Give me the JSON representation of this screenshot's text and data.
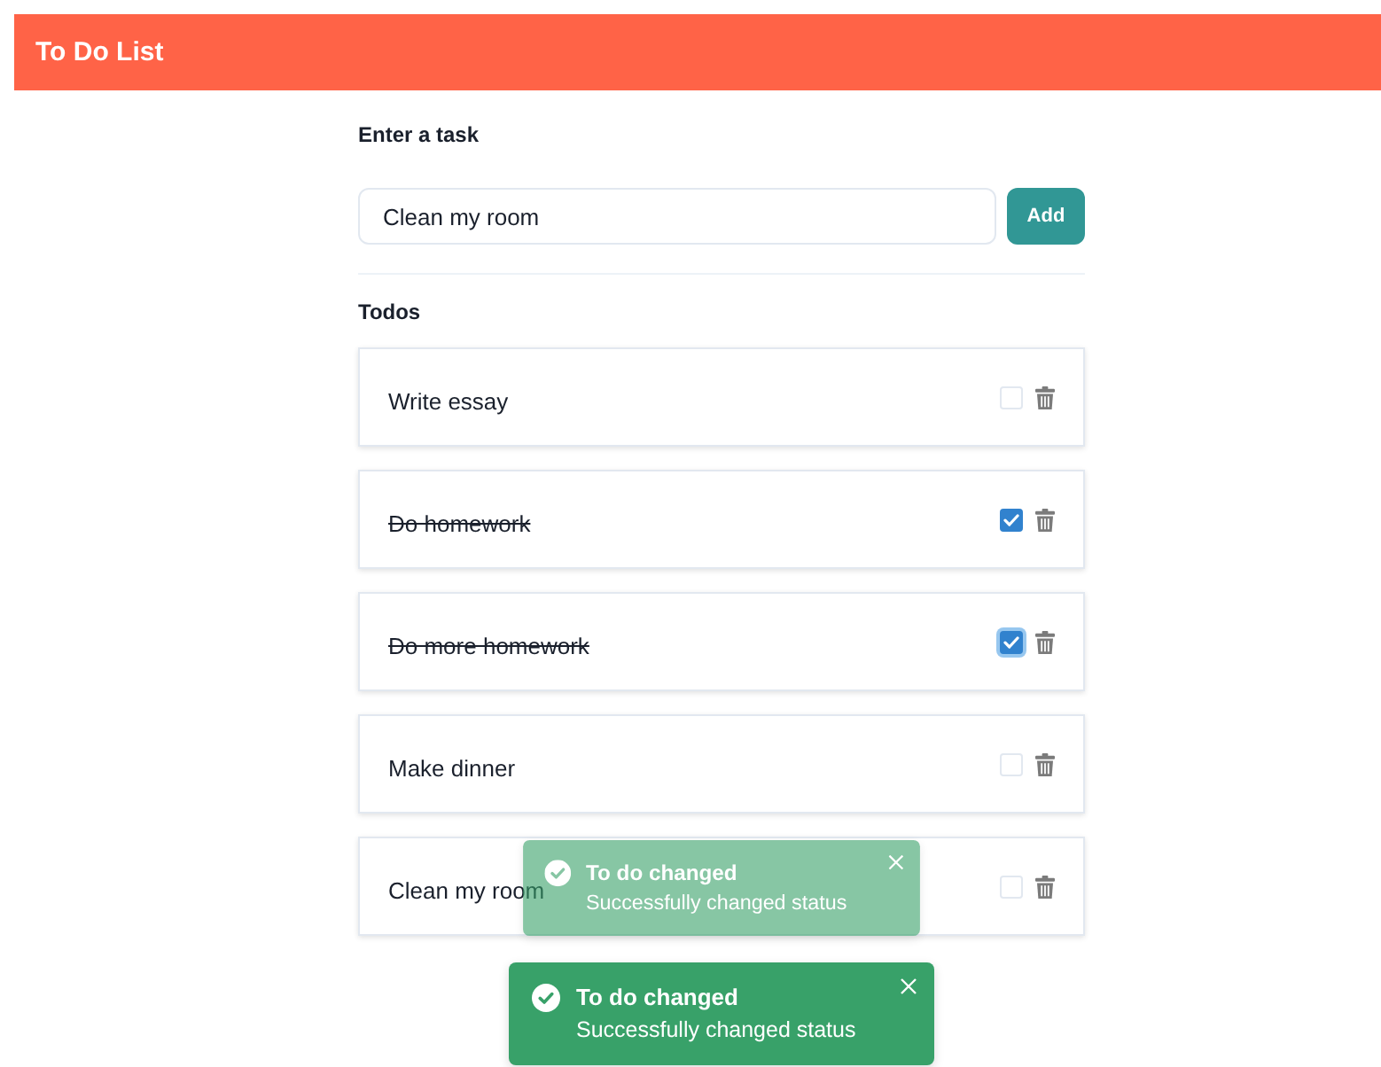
{
  "header": {
    "title": "To Do List"
  },
  "task_form": {
    "label": "Enter a task",
    "input": {
      "value": "Clean my room"
    },
    "button": "Add"
  },
  "todos": {
    "heading": "Todos",
    "items": [
      {
        "text": "Write essay",
        "done": false,
        "focused": false
      },
      {
        "text": "Do homework",
        "done": true,
        "focused": false
      },
      {
        "text": "Do more homework",
        "done": true,
        "focused": true
      },
      {
        "text": "Make dinner",
        "done": false,
        "focused": false
      },
      {
        "text": "Clean my room",
        "done": false,
        "focused": false
      }
    ]
  },
  "toasts": [
    {
      "title": "To do changed",
      "description": "Successfully changed status",
      "faded": true
    },
    {
      "title": "To do changed",
      "description": "Successfully changed status",
      "faded": false
    }
  ]
}
